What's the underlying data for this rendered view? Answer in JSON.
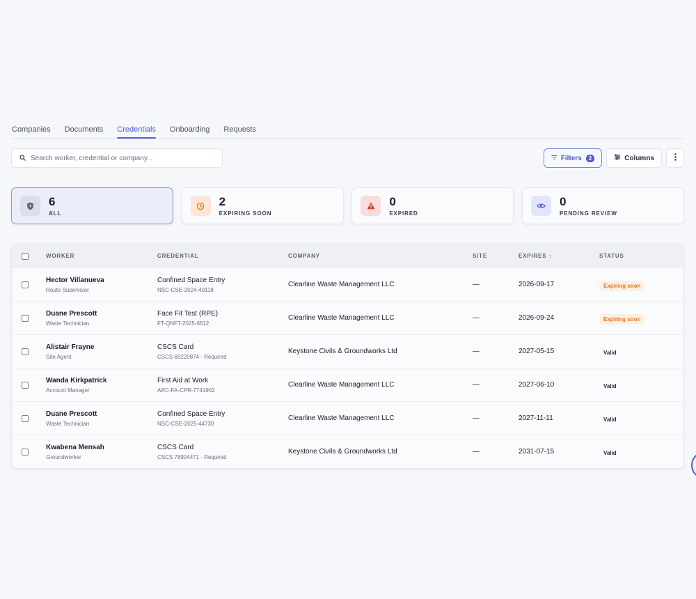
{
  "tabs": [
    {
      "label": "Companies",
      "active": false
    },
    {
      "label": "Documents",
      "active": false
    },
    {
      "label": "Credentials",
      "active": true
    },
    {
      "label": "Onboarding",
      "active": false
    },
    {
      "label": "Requests",
      "active": false
    }
  ],
  "toolbar": {
    "search_placeholder": "Search worker, credential or company...",
    "filters_label": "Filters",
    "filters_count": "2",
    "columns_label": "Columns"
  },
  "stats": [
    {
      "value": "6",
      "label": "ALL",
      "icon": "shield-icon",
      "active": true
    },
    {
      "value": "2",
      "label": "EXPIRING SOON",
      "icon": "clock-icon",
      "active": false
    },
    {
      "value": "0",
      "label": "EXPIRED",
      "icon": "alert-triangle-icon",
      "active": false
    },
    {
      "value": "0",
      "label": "PENDING REVIEW",
      "icon": "eye-icon",
      "active": false
    }
  ],
  "table": {
    "headers": {
      "worker": "WORKER",
      "credential": "CREDENTIAL",
      "company": "COMPANY",
      "site": "SITE",
      "expires": "EXPIRES ↑",
      "status": "STATUS"
    },
    "rows": [
      {
        "worker": "Hector Villanueva",
        "role": "Route Supervisor",
        "credential": "Confined Space Entry",
        "cred_ref": "NSC-CSE-2024-40118",
        "company": "Clearline Waste Management LLC",
        "site": "—",
        "expires": "2026-09-17",
        "status": "Expiring soon",
        "status_kind": "warn"
      },
      {
        "worker": "Duane Prescott",
        "role": "Waste Technician",
        "credential": "Face Fit Test (RPE)",
        "cred_ref": "FT-QNFT-2025-6612",
        "company": "Clearline Waste Management LLC",
        "site": "—",
        "expires": "2026-09-24",
        "status": "Expiring soon",
        "status_kind": "warn"
      },
      {
        "worker": "Alistair Frayne",
        "role": "Site Agent",
        "credential": "CSCS Card",
        "cred_ref": "CSCS 69220874 · Required",
        "company": "Keystone Civils & Groundworks Ltd",
        "site": "—",
        "expires": "2027-05-15",
        "status": "Valid",
        "status_kind": "ok"
      },
      {
        "worker": "Wanda Kirkpatrick",
        "role": "Account Manager",
        "credential": "First Aid at Work",
        "cred_ref": "ARC-FA-CPR-7741902",
        "company": "Clearline Waste Management LLC",
        "site": "—",
        "expires": "2027-06-10",
        "status": "Valid",
        "status_kind": "ok"
      },
      {
        "worker": "Duane Prescott",
        "role": "Waste Technician",
        "credential": "Confined Space Entry",
        "cred_ref": "NSC-CSE-2025-44730",
        "company": "Clearline Waste Management LLC",
        "site": "—",
        "expires": "2027-11-11",
        "status": "Valid",
        "status_kind": "ok"
      },
      {
        "worker": "Kwabena Mensah",
        "role": "Groundworker",
        "credential": "CSCS Card",
        "cred_ref": "CSCS 78904471 · Required",
        "company": "Keystone Civils & Groundworks Ltd",
        "site": "—",
        "expires": "2031-07-15",
        "status": "Valid",
        "status_kind": "ok"
      }
    ]
  },
  "colors": {
    "accent": "#4f5bd5",
    "warn_bg": "#fdf0e3",
    "warn_text": "#e07a1f",
    "danger": "#d9352a"
  }
}
